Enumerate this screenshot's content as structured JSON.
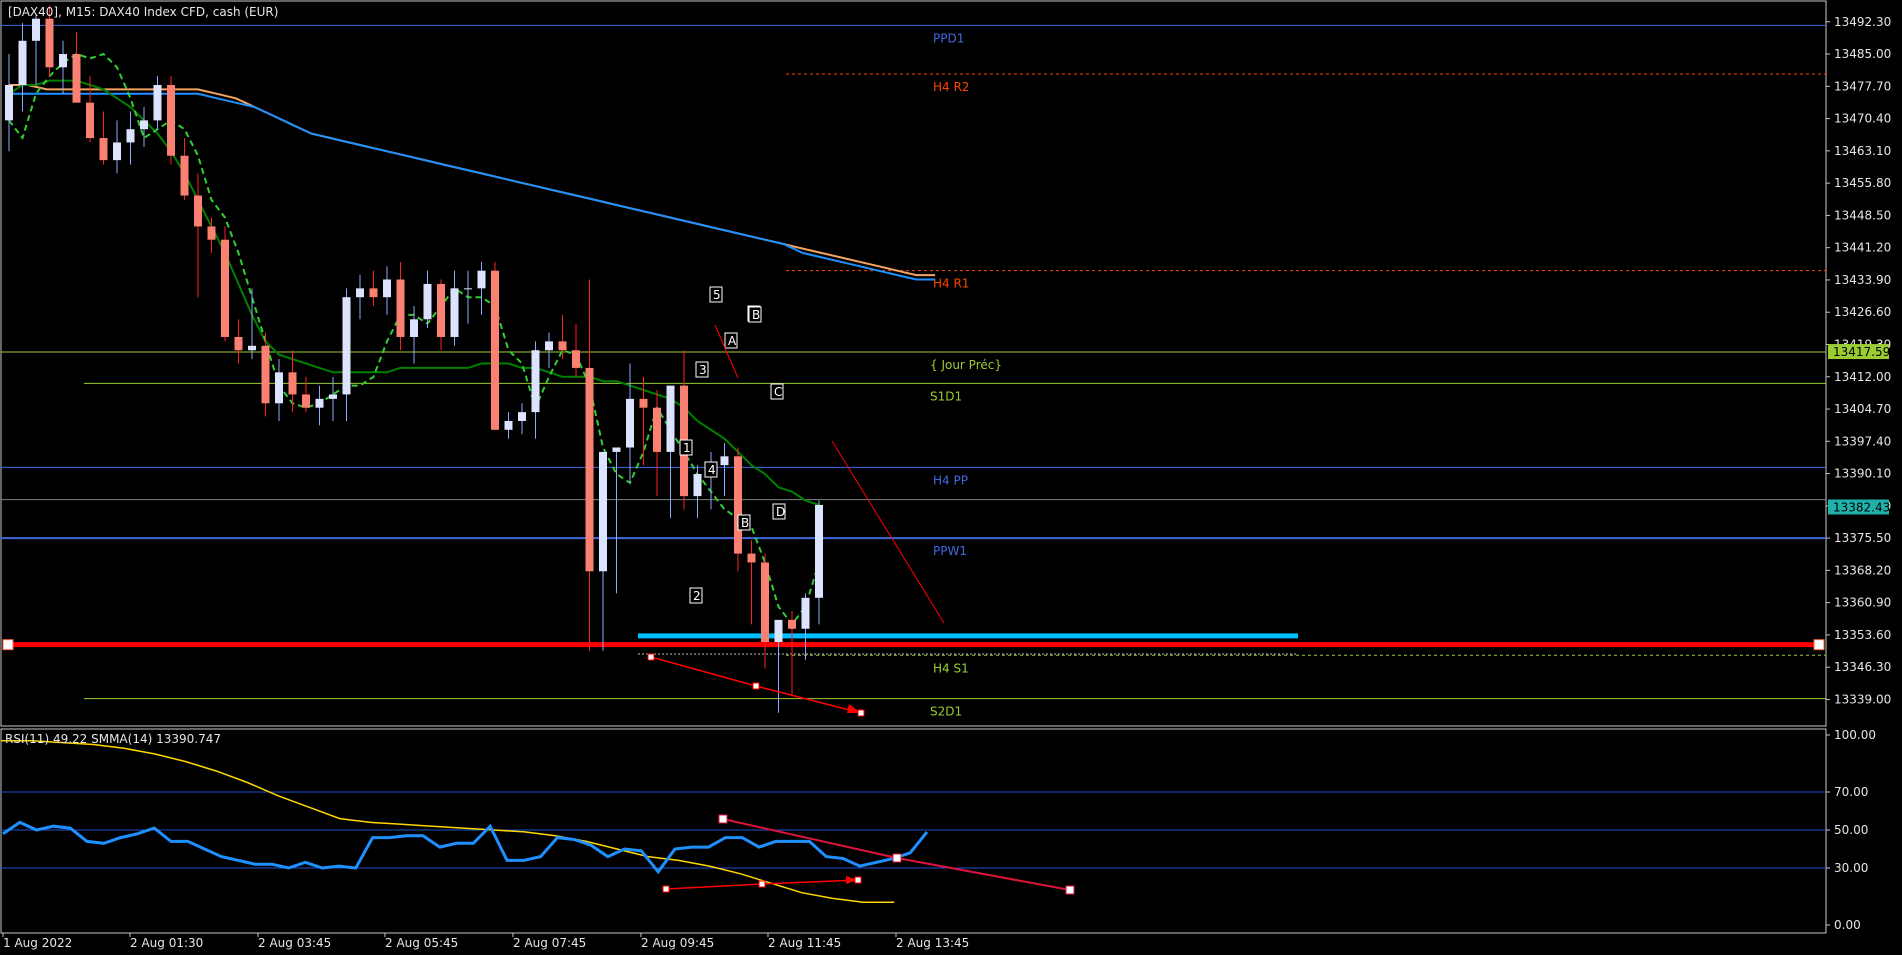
{
  "header": {
    "main": "[DAX40], M15:  DAX40 Index CFD, cash (EUR)",
    "rsi": "RSI(11) 49.22 SMMA(14) 13390.747"
  },
  "colors": {
    "background": "#000000",
    "axis": "#c8c8c8",
    "bull_candle": "#dce3ff",
    "bear_candle": "#fa8072",
    "sma_fast": "#008000",
    "sma_dashed": "#32cd32",
    "ema_blue": "#1e90ff",
    "ema_orange": "#f4a460",
    "pivot_blue": "#4169e1",
    "pivot_red": "#ff4500",
    "pivot_green": "#9acd32",
    "rsi": "#1e90ff",
    "rsi_smma": "#ffd700",
    "support_red": "#ff0000",
    "support_cyan": "#00bfff"
  },
  "chart_data": [
    {
      "type": "candlestick",
      "symbol": "DAX40",
      "timeframe": "M15",
      "ylim": [
        13333.0,
        13497.0
      ],
      "y_ticks": [
        "13492.30",
        "13485.00",
        "13477.70",
        "13470.40",
        "13463.10",
        "13455.80",
        "13448.50",
        "13441.20",
        "13433.90",
        "13426.60",
        "13419.30",
        "13412.00",
        "13404.70",
        "13397.40",
        "13390.10",
        "13382.80",
        "13375.50",
        "13368.20",
        "13360.90",
        "13353.60",
        "13346.30",
        "13339.00"
      ],
      "price_labels": [
        {
          "text": "13417.59",
          "price": 13417.59,
          "bg": "#9acd32"
        },
        {
          "text": "13382.43",
          "price": 13382.43,
          "bg": "#20b2aa"
        }
      ],
      "candles": [
        [
          13470,
          13485,
          13463,
          13478
        ],
        [
          13478,
          13492,
          13472,
          13488
        ],
        [
          13488,
          13494,
          13478,
          13493
        ],
        [
          13493,
          13496,
          13480,
          13482
        ],
        [
          13482,
          13488,
          13476,
          13485
        ],
        [
          13485,
          13490,
          13480,
          13474
        ],
        [
          13474,
          13480,
          13465,
          13466
        ],
        [
          13466,
          13472,
          13460,
          13461
        ],
        [
          13461,
          13470,
          13458,
          13465
        ],
        [
          13465,
          13472,
          13460,
          13468
        ],
        [
          13468,
          13473,
          13464,
          13470
        ],
        [
          13470,
          13480,
          13468,
          13478
        ],
        [
          13478,
          13480,
          13460,
          13462
        ],
        [
          13462,
          13466,
          13452,
          13453
        ],
        [
          13453,
          13458,
          13430,
          13446
        ],
        [
          13446,
          13448,
          13440,
          13443
        ],
        [
          13443,
          13446,
          13420,
          13421
        ],
        [
          13421,
          13425,
          13415,
          13418
        ],
        [
          13418,
          13432,
          13416,
          13419
        ],
        [
          13419,
          13422,
          13403,
          13406
        ],
        [
          13406,
          13416,
          13402,
          13413
        ],
        [
          13413,
          13418,
          13404,
          13408
        ],
        [
          13408,
          13412,
          13404,
          13405
        ],
        [
          13405,
          13410,
          13401,
          13407
        ],
        [
          13407,
          13412,
          13402,
          13408
        ],
        [
          13408,
          13432,
          13402,
          13430
        ],
        [
          13430,
          13435,
          13425,
          13432
        ],
        [
          13432,
          13436,
          13428,
          13430
        ],
        [
          13430,
          13437,
          13426,
          13434
        ],
        [
          13434,
          13438,
          13418,
          13421
        ],
        [
          13421,
          13428,
          13415,
          13425
        ],
        [
          13425,
          13436,
          13423,
          13433
        ],
        [
          13433,
          13434,
          13418,
          13421
        ],
        [
          13421,
          13436,
          13419,
          13432
        ],
        [
          13432,
          13436,
          13424,
          13432
        ],
        [
          13432,
          13438,
          13426,
          13436
        ],
        [
          13436,
          13438,
          13400,
          13400
        ],
        [
          13400,
          13404,
          13398,
          13402
        ],
        [
          13402,
          13406,
          13399,
          13404
        ],
        [
          13404,
          13420,
          13398,
          13418
        ],
        [
          13418,
          13422,
          13414,
          13420
        ],
        [
          13420,
          13426,
          13416,
          13418
        ],
        [
          13418,
          13424,
          13412,
          13414
        ],
        [
          13414,
          13434,
          13350,
          13368
        ],
        [
          13368,
          13395,
          13350,
          13395
        ],
        [
          13395,
          13396,
          13363,
          13396
        ],
        [
          13396,
          13415,
          13388,
          13407
        ],
        [
          13407,
          13412,
          13392,
          13405
        ],
        [
          13405,
          13409,
          13385,
          13395
        ],
        [
          13395,
          13408,
          13380,
          13410
        ],
        [
          13410,
          13418,
          13382,
          13385
        ],
        [
          13385,
          13392,
          13380,
          13390
        ],
        [
          13390,
          13395,
          13382,
          13392
        ],
        [
          13392,
          13397,
          13385,
          13394
        ],
        [
          13394,
          13396,
          13368,
          13372
        ],
        [
          13372,
          13375,
          13356,
          13370
        ],
        [
          13370,
          13372,
          13346,
          13352
        ],
        [
          13352,
          13357,
          13336,
          13357
        ],
        [
          13357,
          13359,
          13340,
          13355
        ],
        [
          13355,
          13363,
          13348,
          13362
        ],
        [
          13362,
          13384,
          13356,
          13383
        ]
      ],
      "series": [
        {
          "name": "SMA fast (dashed)",
          "values": [
            13470,
            13466,
            13476,
            13480,
            13483,
            13485,
            13484,
            13485,
            13482,
            13475,
            13466,
            13468,
            13470,
            13468,
            13462,
            13452,
            13448,
            13440,
            13430,
            13420,
            13410,
            13406,
            13405,
            13406,
            13408,
            13410,
            13410,
            13412,
            13420,
            13426,
            13426,
            13424,
            13428,
            13432,
            13430,
            13430,
            13428,
            13418,
            13415,
            13405,
            13412,
            13418,
            13417,
            13410,
            13396,
            13390,
            13388,
            13395,
            13405,
            13400,
            13395,
            13390,
            13386,
            13382,
            13380,
            13378,
            13370,
            13360,
            13356,
            13360,
            13370
          ]
        },
        {
          "name": "SMA 21 (green)",
          "values": [
            13476,
            13478,
            13478,
            13479,
            13479,
            13479,
            13478,
            13477,
            13475,
            13473,
            13470,
            13467,
            13463,
            13458,
            13452,
            13446,
            13440,
            13433,
            13426,
            13420,
            13417,
            13416,
            13415,
            13414,
            13413,
            13413,
            13413,
            13413,
            13413,
            13414,
            13414,
            13414,
            13414,
            13414,
            13414,
            13415,
            13415,
            13415,
            13414,
            13414,
            13413,
            13412,
            13412,
            13412,
            13411,
            13411,
            13410,
            13409,
            13408,
            13407,
            13405,
            13402,
            13400,
            13398,
            13395,
            13392,
            13390,
            13387,
            13386,
            13384,
            13383
          ]
        },
        {
          "name": "EMA blue",
          "values": [
            13476,
            13476,
            13476,
            13476,
            13476,
            13476,
            13476,
            13476,
            13476,
            13476,
            13476,
            13475,
            13474,
            13473,
            13471,
            13469,
            13467,
            13466,
            13465,
            13464,
            13463,
            13462,
            13461,
            13460,
            13459,
            13458,
            13457,
            13456,
            13455,
            13454,
            13453,
            13452,
            13451,
            13450,
            13449,
            13448,
            13447,
            13446,
            13445,
            13444,
            13443,
            13442,
            13440,
            13439,
            13438,
            13437,
            13436,
            13435,
            13434,
            13434
          ]
        },
        {
          "name": "EMA orange",
          "values": [
            13478,
            13478,
            13477,
            13477,
            13477,
            13477,
            13477,
            13477,
            13477,
            13477,
            13477,
            13476,
            13475,
            13473,
            13471,
            13469,
            13467,
            13466,
            13465,
            13464,
            13463,
            13462,
            13461,
            13460,
            13459,
            13458,
            13457,
            13456,
            13455,
            13454,
            13453,
            13452,
            13451,
            13450,
            13449,
            13448,
            13447,
            13446,
            13445,
            13444,
            13443,
            13442,
            13441,
            13440,
            13439,
            13438,
            13437,
            13436,
            13435,
            13435
          ]
        }
      ],
      "pivot_lines": [
        {
          "label": "PPD1",
          "price": 13491.5,
          "color": "#4169e1",
          "style": "solid"
        },
        {
          "label": "H4 R2",
          "price": 13480.5,
          "color": "#ff4500",
          "style": "dotted"
        },
        {
          "label": "H4 R1",
          "price": 13436.0,
          "color": "#ff4500",
          "style": "dotted"
        },
        {
          "label": "{ Jour Préc}",
          "price": 13417.59,
          "color": "#9acd32",
          "style": "solid"
        },
        {
          "label": "S1D1",
          "price": 13410.5,
          "color": "#9acd32",
          "style": "solid"
        },
        {
          "label": "H4 PP",
          "price": 13391.5,
          "color": "#4169e1",
          "style": "solid"
        },
        {
          "label": "PPW1",
          "price": 13375.5,
          "color": "#4169e1",
          "style": "solid"
        },
        {
          "label": "H4 S1",
          "price": 13349.0,
          "color": "#9acd32",
          "style": "dotted"
        },
        {
          "label": "S2D1",
          "price": 13339.2,
          "color": "#9acd32",
          "style": "solid"
        }
      ],
      "wave_labels": [
        "1",
        "2",
        "3",
        "4",
        "5",
        "A",
        "B",
        "C",
        "C",
        "B",
        "D"
      ],
      "x_ticks": [
        "1 Aug 2022",
        "2 Aug 01:30",
        "2 Aug 03:45",
        "2 Aug 05:45",
        "2 Aug 07:45",
        "2 Aug 09:45",
        "2 Aug 11:45",
        "2 Aug 13:45"
      ]
    },
    {
      "type": "line",
      "name": "RSI(11)",
      "ylim": [
        0,
        100
      ],
      "y_ticks": [
        "100.00",
        "70.00",
        "50.00",
        "30.00",
        "0.00"
      ],
      "levels": [
        70,
        50,
        30
      ],
      "series": [
        {
          "name": "RSI",
          "values": [
            48,
            54,
            50,
            52,
            51,
            44,
            43,
            46,
            48,
            51,
            44,
            44,
            40,
            36,
            34,
            32,
            32,
            30,
            33,
            30,
            31,
            30,
            46,
            46,
            47,
            47,
            41,
            43,
            43,
            52,
            34,
            34,
            36,
            46,
            45,
            42,
            36,
            40,
            39,
            28,
            40,
            41,
            41,
            46,
            46,
            41,
            44,
            44,
            44,
            36,
            35,
            31,
            33,
            35,
            38,
            49
          ]
        },
        {
          "name": "SMMA(14)",
          "values": [
            97,
            97,
            96,
            95,
            93,
            90,
            86,
            81,
            75,
            68,
            62,
            56,
            54,
            53,
            52,
            51,
            50,
            49,
            47,
            44,
            40,
            36,
            34,
            31,
            27,
            22,
            17,
            14,
            12,
            12
          ]
        }
      ]
    }
  ]
}
